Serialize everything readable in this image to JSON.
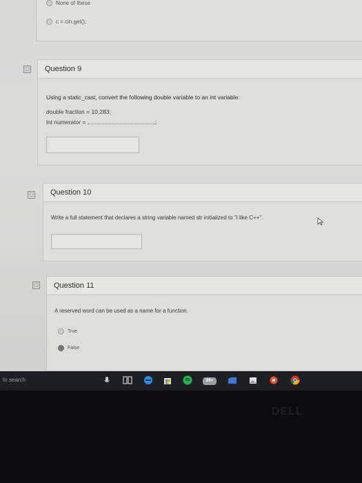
{
  "prev_question": {
    "options": [
      {
        "label": "None of these",
        "selected": false
      },
      {
        "label": "c = cin.get();",
        "selected": false
      }
    ]
  },
  "questions": [
    {
      "title": "Question 9",
      "prompt": "Using a static_cast, convert the following double variable to an int variable:",
      "code_line1": "double fraction = 10.283;",
      "code_line2_prefix": "int numerator =",
      "code_line2_suffix": ";"
    },
    {
      "title": "Question 10",
      "prompt": "Write a full statement that declares a string variable named str initialized to \"I like C++\"."
    },
    {
      "title": "Question 11",
      "prompt": "A reserved word can be used as a name for a function.",
      "options": [
        {
          "label": "True",
          "selected": false
        },
        {
          "label": "False",
          "selected": true
        }
      ]
    }
  ],
  "taskbar": {
    "search_placeholder": "to search",
    "badge": "99+"
  },
  "bezel": {
    "logo": "DELL"
  },
  "colors": {
    "accent_blue": "#2d8cf0",
    "spotify_green": "#1db954",
    "chrome_red": "#d93025"
  }
}
